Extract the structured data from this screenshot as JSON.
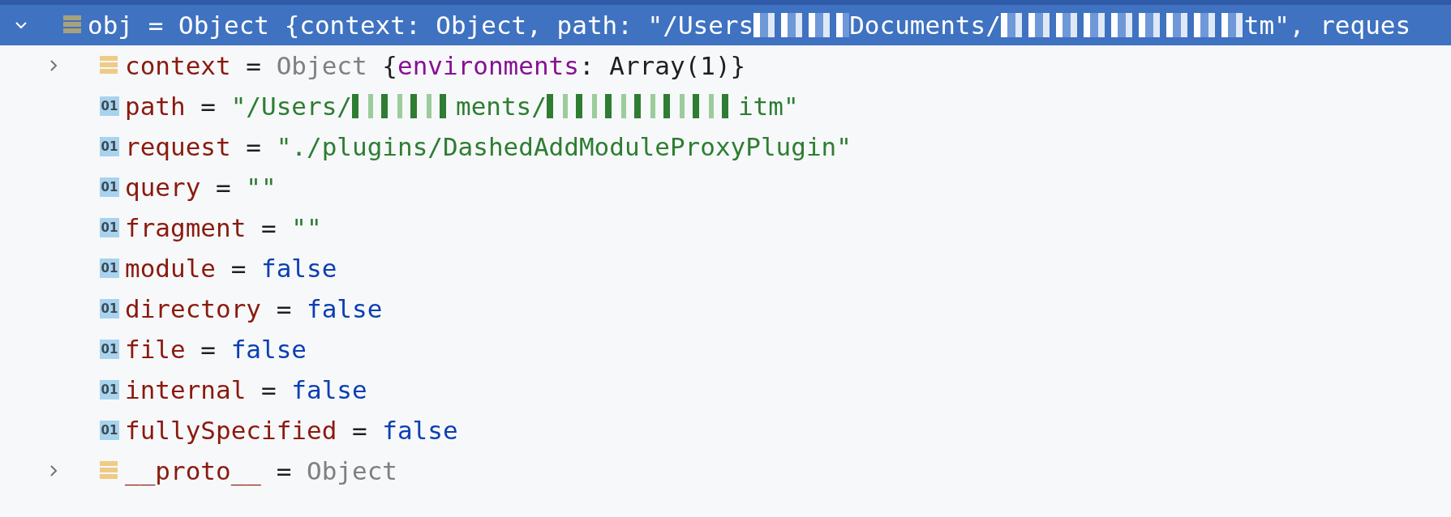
{
  "root": {
    "name": "obj",
    "expanded": true,
    "selected": true,
    "summary": [
      {
        "kind": "text",
        "text": "= Object {context: Object, path: \"/Users"
      },
      {
        "kind": "redacted"
      },
      {
        "kind": "text",
        "text": "Documents/"
      },
      {
        "kind": "redacted"
      },
      {
        "kind": "text",
        "text": "tm\", reques"
      }
    ]
  },
  "children": [
    {
      "kind": "object",
      "expanded": false,
      "name": "context",
      "separator": "=",
      "value": [
        {
          "kind": "type",
          "text": "Object"
        },
        {
          "kind": "punct",
          "text": " {"
        },
        {
          "kind": "prop",
          "text": "environments"
        },
        {
          "kind": "punct",
          "text": ": Array(1)}"
        }
      ]
    },
    {
      "kind": "primitive",
      "badge": "01",
      "name": "path",
      "separator": "=",
      "value": [
        {
          "kind": "string",
          "text": "\"/Users/"
        },
        {
          "kind": "redacted"
        },
        {
          "kind": "string",
          "text": "ments/"
        },
        {
          "kind": "redacted"
        },
        {
          "kind": "string",
          "text": "itm\""
        }
      ]
    },
    {
      "kind": "primitive",
      "badge": "01",
      "name": "request",
      "separator": "=",
      "value": [
        {
          "kind": "string",
          "text": "\"./plugins/DashedAddModuleProxyPlugin\""
        }
      ]
    },
    {
      "kind": "primitive",
      "badge": "01",
      "name": "query",
      "separator": "=",
      "value": [
        {
          "kind": "string",
          "text": "\"\""
        }
      ]
    },
    {
      "kind": "primitive",
      "badge": "01",
      "name": "fragment",
      "separator": "=",
      "value": [
        {
          "kind": "string",
          "text": "\"\""
        }
      ]
    },
    {
      "kind": "primitive",
      "badge": "01",
      "name": "module",
      "separator": "=",
      "value": [
        {
          "kind": "keyword",
          "text": "false"
        }
      ]
    },
    {
      "kind": "primitive",
      "badge": "01",
      "name": "directory",
      "separator": "=",
      "value": [
        {
          "kind": "keyword",
          "text": "false"
        }
      ]
    },
    {
      "kind": "primitive",
      "badge": "01",
      "name": "file",
      "separator": "=",
      "value": [
        {
          "kind": "keyword",
          "text": "false"
        }
      ]
    },
    {
      "kind": "primitive",
      "badge": "01",
      "name": "internal",
      "separator": "=",
      "value": [
        {
          "kind": "keyword",
          "text": "false"
        }
      ]
    },
    {
      "kind": "primitive",
      "badge": "01",
      "name": "fullySpecified",
      "separator": "=",
      "value": [
        {
          "kind": "keyword",
          "text": "false"
        }
      ]
    },
    {
      "kind": "object",
      "expanded": false,
      "name": "__proto__",
      "separator": "=",
      "value": [
        {
          "kind": "type",
          "text": "Object"
        }
      ]
    }
  ]
}
